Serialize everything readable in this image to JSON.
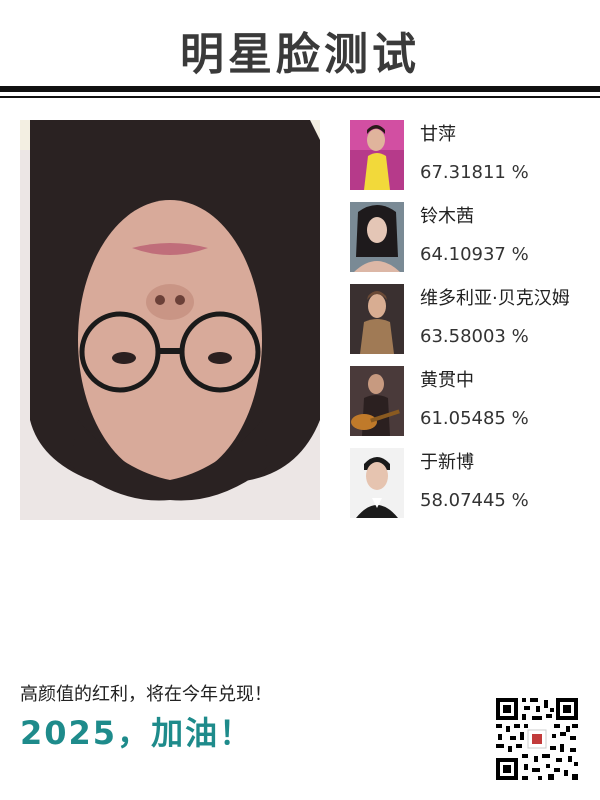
{
  "header": {
    "title": "明星脸测试"
  },
  "user_photo": {
    "icon": "user-face-photo"
  },
  "matches": [
    {
      "name": "甘萍",
      "score": "67.31811 %",
      "icon": "celebrity-photo"
    },
    {
      "name": "铃木茜",
      "score": "64.10937 %",
      "icon": "celebrity-photo"
    },
    {
      "name": "维多利亚·贝克汉姆",
      "score": "63.58003 %",
      "icon": "celebrity-photo"
    },
    {
      "name": "黄贯中",
      "score": "61.05485 %",
      "icon": "celebrity-photo"
    },
    {
      "name": "于新博",
      "score": "58.07445 %",
      "icon": "celebrity-photo"
    }
  ],
  "footer": {
    "text": "高颜值的红利，将在今年兑现！",
    "slogan": "2025，加油！",
    "qr_icon": "qr-code-icon"
  },
  "colors": {
    "accent": "#1e8b8b",
    "rule": "#111111"
  }
}
